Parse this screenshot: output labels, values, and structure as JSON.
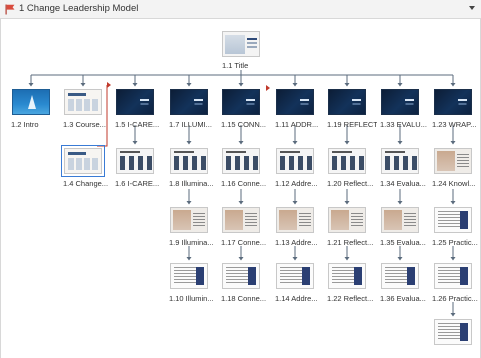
{
  "window": {
    "title": "1 Change Leadership Model",
    "flag_icon": "flag-icon",
    "collapse_icon": "chevron-down-icon"
  },
  "root": {
    "label": "1.1 Title"
  },
  "columns": [
    {
      "id": "c0",
      "items": [
        "1.2 Intro"
      ]
    },
    {
      "id": "c1",
      "items": [
        "1.3 Course...",
        "1.4 Change..."
      ]
    },
    {
      "id": "c2",
      "items": [
        "1.5 I-CARE...",
        "1.6 I-CARE..."
      ]
    },
    {
      "id": "c3",
      "items": [
        "1.7 ILLUMI...",
        "1.8 Illumina...",
        "1.9 Illumina...",
        "1.10 Illumin..."
      ]
    },
    {
      "id": "c4",
      "items": [
        "1.15 CONN...",
        "1.16 Conne...",
        "1.17 Conne...",
        "1.18 Conne..."
      ]
    },
    {
      "id": "c5",
      "items": [
        "1.11 ADDR...",
        "1.12 Addre...",
        "1.13 Addre...",
        "1.14 Addre..."
      ]
    },
    {
      "id": "c6",
      "items": [
        "1.19 REFLECT",
        "1.20 Reflect...",
        "1.21 Reflect...",
        "1.22 Reflect..."
      ]
    },
    {
      "id": "c7",
      "items": [
        "1.33 EVALU...",
        "1.34 Evalua...",
        "1.35 Evalua...",
        "1.36 Evalua..."
      ]
    },
    {
      "id": "c8",
      "items": [
        "1.23 WRAP...",
        "1.24 Knowl...",
        "1.25 Practic...",
        "1.26 Practic...",
        ""
      ]
    }
  ],
  "colors": {
    "accent": "#3a7bd5",
    "connector": "#5b6b7d",
    "branch_marker": "#c0392b"
  }
}
